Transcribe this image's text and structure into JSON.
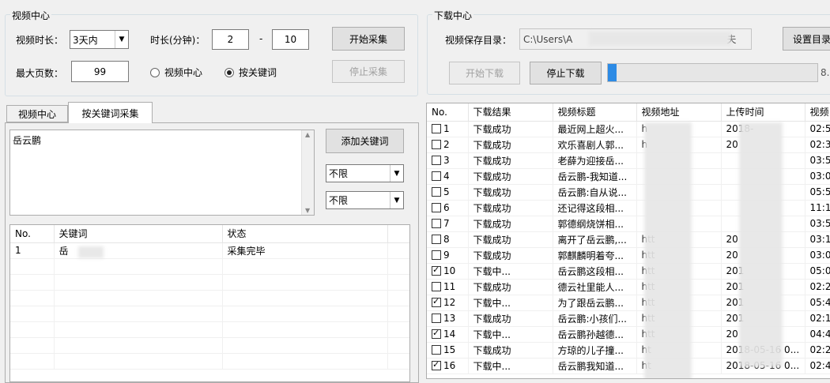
{
  "video_center": {
    "group_title": "视频中心",
    "duration_label": "视频时长：",
    "duration_value": "3天内",
    "minutes_label": "时长(分钟)：",
    "min_from": "2",
    "dash": "-",
    "min_to": "10",
    "start_button": "开始采集",
    "max_pages_label": "最大页数：",
    "max_pages": "99",
    "radio_center": "视频中心",
    "radio_keyword": "按关键词",
    "stop_button": "停止采集"
  },
  "download_center": {
    "group_title": "下载中心",
    "save_dir_label": "视频保存目录：",
    "save_dir_value": "C:\\Users\\A",
    "save_dir_tail": "夫",
    "set_dir_button": "设置目录",
    "start_download": "开始下载",
    "stop_download": "停止下载",
    "progress_text": "8.",
    "progress_fraction": 0.04
  },
  "left_tabs": [
    "视频中心",
    "按关键词采集"
  ],
  "keyword_area": {
    "text": "岳云鹏",
    "add_button": "添加关键词",
    "filter1": "不限",
    "filter2": "不限"
  },
  "keyword_table": {
    "headers": [
      "No.",
      "关键词",
      "状态"
    ],
    "rows": [
      {
        "no": "1",
        "keyword": "岳",
        "status": "采集完毕"
      }
    ]
  },
  "download_table": {
    "headers": [
      "No.",
      "下载结果",
      "视频标题",
      "视频地址",
      "上传时间",
      "视频"
    ],
    "rows": [
      {
        "no": "1",
        "checked": false,
        "result": "下载成功",
        "title": "最近网上超火...",
        "url": "h",
        "time": "2018-",
        "len": "02:5"
      },
      {
        "no": "2",
        "checked": false,
        "result": "下载成功",
        "title": "欢乐喜剧人郭...",
        "url": "h",
        "time": "20",
        "len": "02:3"
      },
      {
        "no": "3",
        "checked": false,
        "result": "下载成功",
        "title": "老薛为迎接岳...",
        "url": "",
        "time": "",
        "len": "03:5"
      },
      {
        "no": "4",
        "checked": false,
        "result": "下载成功",
        "title": "岳云鹏-我知道...",
        "url": "",
        "time": "",
        "len": "03:0"
      },
      {
        "no": "5",
        "checked": false,
        "result": "下载成功",
        "title": "岳云鹏:自从说...",
        "url": "",
        "time": "",
        "len": "05:5"
      },
      {
        "no": "6",
        "checked": false,
        "result": "下载成功",
        "title": "还记得这段相...",
        "url": "",
        "time": "",
        "len": "11:1"
      },
      {
        "no": "7",
        "checked": false,
        "result": "下载成功",
        "title": "郭德纲烧饼相...",
        "url": "",
        "time": "",
        "len": "03:5"
      },
      {
        "no": "8",
        "checked": false,
        "result": "下载成功",
        "title": "离开了岳云鹏,...",
        "url": "htt",
        "time": "20",
        "len": "03:1"
      },
      {
        "no": "9",
        "checked": false,
        "result": "下载成功",
        "title": "郭麒麟明着夸...",
        "url": "htt",
        "time": "20",
        "len": "03:0"
      },
      {
        "no": "10",
        "checked": true,
        "result": "下载中...",
        "title": "岳云鹏这段相...",
        "url": "htt",
        "time": "201",
        "len": "05:0"
      },
      {
        "no": "11",
        "checked": false,
        "result": "下载成功",
        "title": "德云社里能人...",
        "url": "htt",
        "time": "201",
        "len": "02:2"
      },
      {
        "no": "12",
        "checked": true,
        "result": "下载中...",
        "title": "为了跟岳云鹏...",
        "url": "htt",
        "time": "201",
        "len": "05:4"
      },
      {
        "no": "13",
        "checked": false,
        "result": "下载成功",
        "title": "岳云鹏:小孩们...",
        "url": "htt",
        "time": "201",
        "len": "02:1"
      },
      {
        "no": "14",
        "checked": true,
        "result": "下载中...",
        "title": "岳云鹏孙越德...",
        "url": "htt",
        "time": "20",
        "len": "04:4"
      },
      {
        "no": "15",
        "checked": false,
        "result": "下载成功",
        "title": "方琼的儿子撞...",
        "url": "ht",
        "time": "2018-05-16 0...",
        "len": "02:2"
      },
      {
        "no": "16",
        "checked": true,
        "result": "下载中...",
        "title": "岳云鹏我知道...",
        "url": "ht",
        "time": "2018-05-16 0...",
        "len": "02:4"
      }
    ]
  }
}
